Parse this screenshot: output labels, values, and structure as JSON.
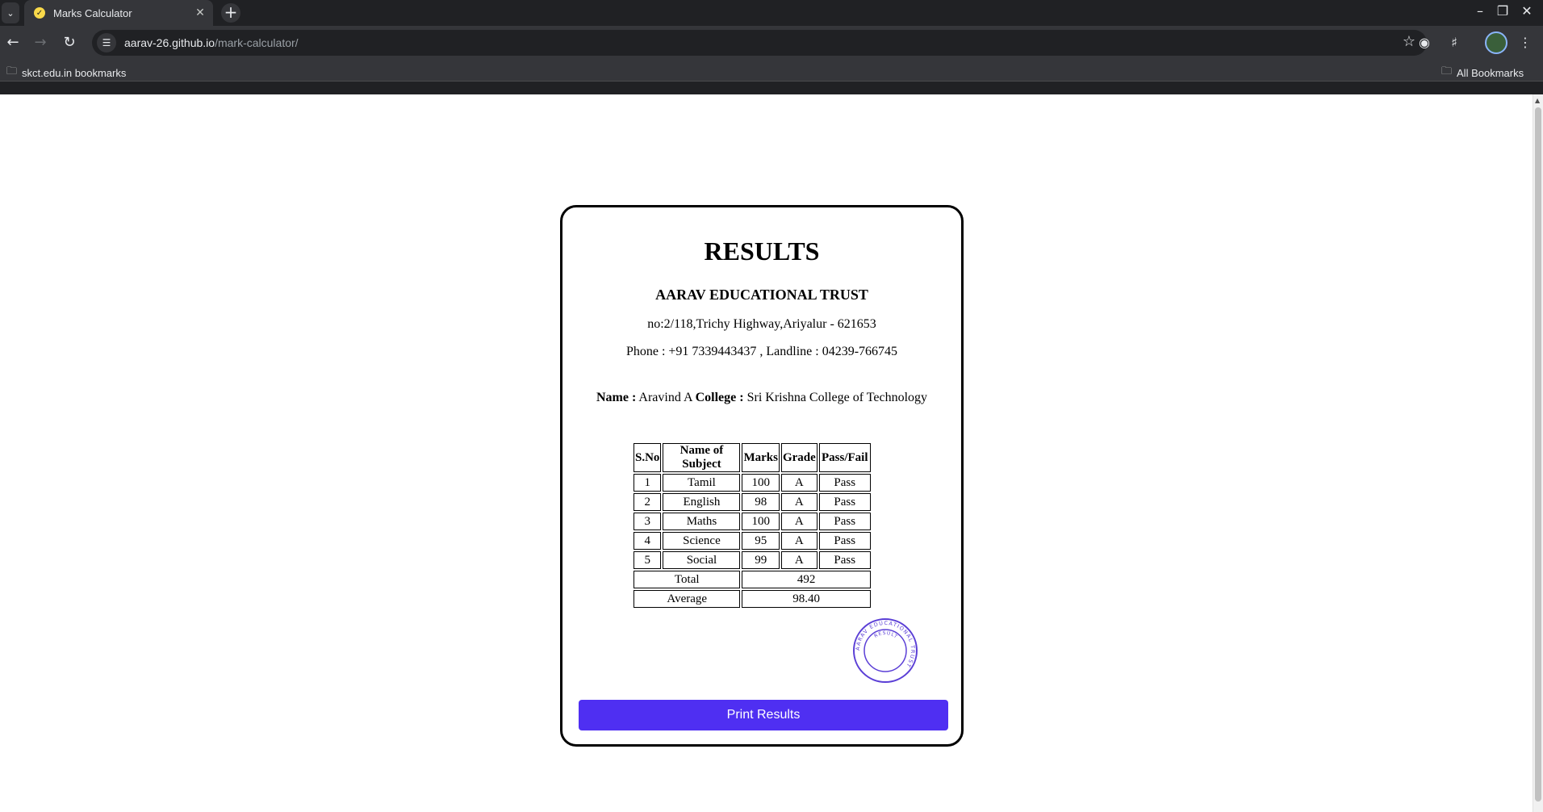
{
  "browser": {
    "tab_title": "Marks Calculator",
    "url_host": "aarav-26.github.io",
    "url_path": "/mark-calculator/",
    "bookmark_folder": "skct.edu.in bookmarks",
    "all_bookmarks": "All Bookmarks"
  },
  "results": {
    "heading": "RESULTS",
    "institution": "AARAV EDUCATIONAL TRUST",
    "address": "no:2/118,Trichy Highway,Ariyalur - 621653",
    "phone": "Phone : +91 7339443437 , Landline : 04239-766745",
    "name_label": "Name :",
    "name_value": "Aravind A",
    "college_label": "College :",
    "college_value": "Sri Krishna College of Technology",
    "columns": [
      "S.No",
      "Name of Subject",
      "Marks",
      "Grade",
      "Pass/Fail"
    ],
    "rows": [
      {
        "sno": "1",
        "subject": "Tamil",
        "marks": "100",
        "grade": "A",
        "status": "Pass"
      },
      {
        "sno": "2",
        "subject": "English",
        "marks": "98",
        "grade": "A",
        "status": "Pass"
      },
      {
        "sno": "3",
        "subject": "Maths",
        "marks": "100",
        "grade": "A",
        "status": "Pass"
      },
      {
        "sno": "4",
        "subject": "Science",
        "marks": "95",
        "grade": "A",
        "status": "Pass"
      },
      {
        "sno": "5",
        "subject": "Social",
        "marks": "99",
        "grade": "A",
        "status": "Pass"
      }
    ],
    "total_label": "Total",
    "total_value": "492",
    "average_label": "Average",
    "average_value": "98.40",
    "stamp_text_outer": "AARAV EDUCATIONAL TRUST",
    "stamp_text_inner": "RESULT",
    "print_button": "Print Results"
  },
  "colors": {
    "accent": "#4f2ff2",
    "stamp": "#5b3fd6",
    "chrome_bg": "#202124"
  }
}
